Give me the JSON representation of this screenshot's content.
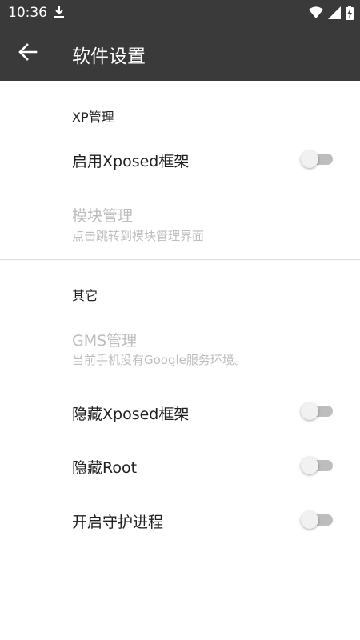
{
  "status_bar": {
    "time": "10:36"
  },
  "app_bar": {
    "title": "软件设置"
  },
  "sections": {
    "xp": {
      "header": "XP管理",
      "enable_xposed": "启用Xposed框架",
      "module_manage": {
        "title": "模块管理",
        "subtitle": "点击跳转到模块管理界面"
      }
    },
    "other": {
      "header": "其它",
      "gms": {
        "title": "GMS管理",
        "subtitle": "当前手机没有Google服务环境。"
      },
      "hide_xposed": "隐藏Xposed框架",
      "hide_root": "隐藏Root",
      "daemon": "开启守护进程"
    }
  },
  "colors": {
    "appbar": "#3a3a3a",
    "switch_off_track": "#bdbdbd",
    "disabled_text": "#bdbdbd"
  }
}
